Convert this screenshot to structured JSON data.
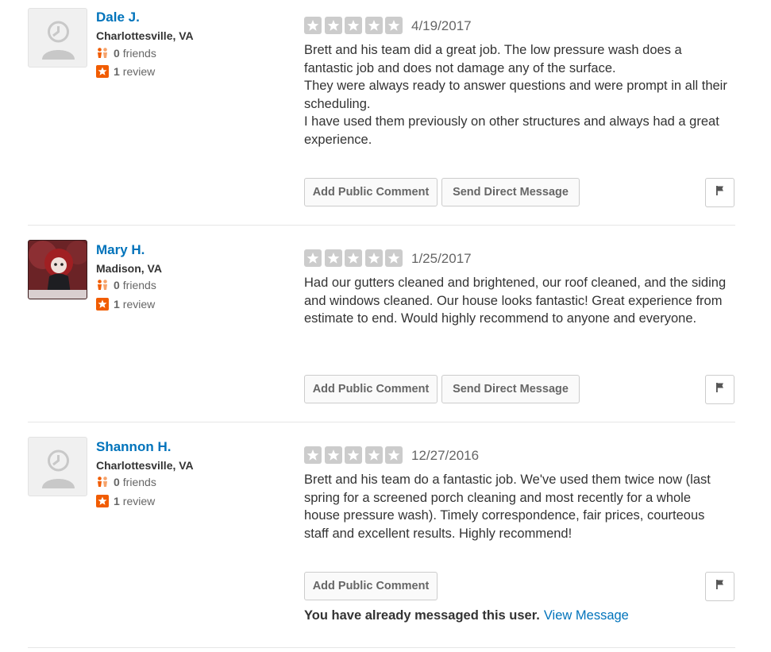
{
  "colors": {
    "link": "#0073bb",
    "star_empty": "#cccccc",
    "friends_icon": "#f15c00",
    "review_icon": "#f15c00"
  },
  "reviews": [
    {
      "user": {
        "name": "Dale J.",
        "location": "Charlottesville, VA",
        "friends_count": "0",
        "friends_label": "friends",
        "reviews_count": "1",
        "reviews_label": "review",
        "avatar": "default-avatar-icon"
      },
      "rating": 5,
      "date": "4/19/2017",
      "text": "Brett and his team did a great job. The low pressure wash does a fantastic job and does not damage any of the surface.\nThey were always ready to answer questions and were prompt in all their scheduling.\nI have used them previously on other structures and always had a great experience.",
      "add_comment_label": "Add Public Comment",
      "send_message_label": "Send Direct Message"
    },
    {
      "user": {
        "name": "Mary H.",
        "location": "Madison, VA",
        "friends_count": "0",
        "friends_label": "friends",
        "reviews_count": "1",
        "reviews_label": "review",
        "avatar": "doll-photo-avatar"
      },
      "rating": 5,
      "date": "1/25/2017",
      "text": "Had our gutters cleaned and brightened, our roof cleaned, and the siding and windows cleaned.  Our house looks fantastic!  Great experience from estimate to end.  Would highly recommend to anyone and everyone.",
      "add_comment_label": "Add Public Comment",
      "send_message_label": "Send Direct Message"
    },
    {
      "user": {
        "name": "Shannon H.",
        "location": "Charlottesville, VA",
        "friends_count": "0",
        "friends_label": "friends",
        "reviews_count": "1",
        "reviews_label": "review",
        "avatar": "default-avatar-icon"
      },
      "rating": 5,
      "date": "12/27/2016",
      "text": "Brett and his team do a fantastic job.  We've used them twice now (last spring for a screened porch cleaning and most recently for a whole house pressure wash).  Timely correspondence, fair prices, courteous staff and excellent results.  Highly recommend!",
      "add_comment_label": "Add Public Comment",
      "messaged_notice": "You have already messaged this user.",
      "view_message_label": "View Message"
    }
  ]
}
